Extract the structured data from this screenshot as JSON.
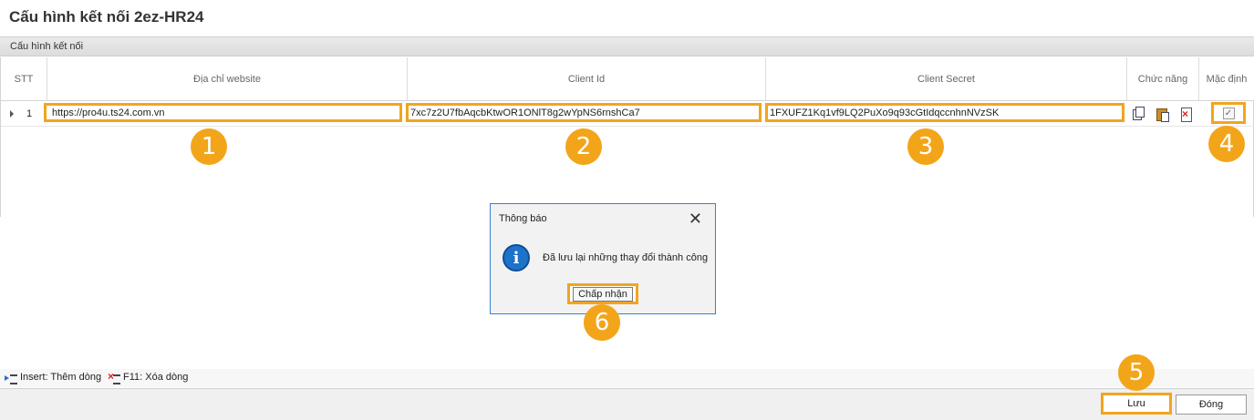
{
  "window": {
    "title": "Cấu hình kết nối 2ez-HR24"
  },
  "section": {
    "label": "Cấu hình kết nối"
  },
  "grid": {
    "columns": [
      {
        "key": "stt",
        "label": "STT"
      },
      {
        "key": "website",
        "label": "Địa chỉ website"
      },
      {
        "key": "client_id",
        "label": "Client Id"
      },
      {
        "key": "client_secret",
        "label": "Client Secret"
      },
      {
        "key": "functions",
        "label": "Chức năng"
      },
      {
        "key": "default",
        "label": "Mặc định"
      }
    ],
    "rows": [
      {
        "stt": "1",
        "website": "https://pro4u.ts24.com.vn",
        "client_id": "7xc7z2U7fbAqcbKtwOR1ONlT8g2wYpNS6rnshCa7",
        "client_secret": "1FXUFZ1Kq1vf9LQ2PuXo9q93cGtIdqccnhnNVzSK",
        "default": true
      }
    ],
    "row_icons": [
      "copy-icon",
      "paste-icon",
      "delete-icon"
    ]
  },
  "badges": [
    "1",
    "2",
    "3",
    "4",
    "5",
    "6"
  ],
  "dialog": {
    "title": "Thông báo",
    "message": "Đã lưu lại những thay đổi thành công",
    "accept_label": "Chấp nhận"
  },
  "hints": {
    "insert": "Insert: Thêm dòng",
    "delete": "F11: Xóa dòng"
  },
  "footer": {
    "save_label": "Lưu",
    "close_label": "Đóng"
  },
  "colors": {
    "highlight": "#f0a51f",
    "badge": "#f3a51a",
    "info": "#1d73c9",
    "dialog_border": "#3c7fd0"
  }
}
